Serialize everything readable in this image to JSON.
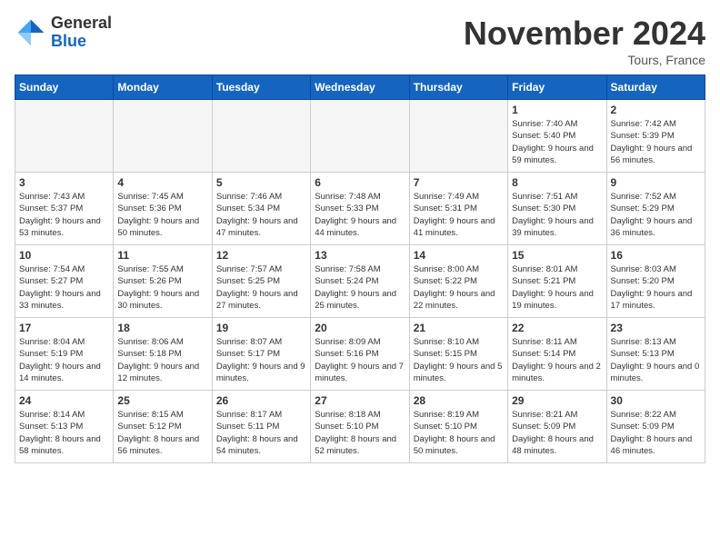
{
  "logo": {
    "general": "General",
    "blue": "Blue"
  },
  "header": {
    "month": "November 2024",
    "location": "Tours, France"
  },
  "weekdays": [
    "Sunday",
    "Monday",
    "Tuesday",
    "Wednesday",
    "Thursday",
    "Friday",
    "Saturday"
  ],
  "weeks": [
    [
      {
        "day": "",
        "info": ""
      },
      {
        "day": "",
        "info": ""
      },
      {
        "day": "",
        "info": ""
      },
      {
        "day": "",
        "info": ""
      },
      {
        "day": "",
        "info": ""
      },
      {
        "day": "1",
        "info": "Sunrise: 7:40 AM\nSunset: 5:40 PM\nDaylight: 9 hours and 59 minutes."
      },
      {
        "day": "2",
        "info": "Sunrise: 7:42 AM\nSunset: 5:39 PM\nDaylight: 9 hours and 56 minutes."
      }
    ],
    [
      {
        "day": "3",
        "info": "Sunrise: 7:43 AM\nSunset: 5:37 PM\nDaylight: 9 hours and 53 minutes."
      },
      {
        "day": "4",
        "info": "Sunrise: 7:45 AM\nSunset: 5:36 PM\nDaylight: 9 hours and 50 minutes."
      },
      {
        "day": "5",
        "info": "Sunrise: 7:46 AM\nSunset: 5:34 PM\nDaylight: 9 hours and 47 minutes."
      },
      {
        "day": "6",
        "info": "Sunrise: 7:48 AM\nSunset: 5:33 PM\nDaylight: 9 hours and 44 minutes."
      },
      {
        "day": "7",
        "info": "Sunrise: 7:49 AM\nSunset: 5:31 PM\nDaylight: 9 hours and 41 minutes."
      },
      {
        "day": "8",
        "info": "Sunrise: 7:51 AM\nSunset: 5:30 PM\nDaylight: 9 hours and 39 minutes."
      },
      {
        "day": "9",
        "info": "Sunrise: 7:52 AM\nSunset: 5:29 PM\nDaylight: 9 hours and 36 minutes."
      }
    ],
    [
      {
        "day": "10",
        "info": "Sunrise: 7:54 AM\nSunset: 5:27 PM\nDaylight: 9 hours and 33 minutes."
      },
      {
        "day": "11",
        "info": "Sunrise: 7:55 AM\nSunset: 5:26 PM\nDaylight: 9 hours and 30 minutes."
      },
      {
        "day": "12",
        "info": "Sunrise: 7:57 AM\nSunset: 5:25 PM\nDaylight: 9 hours and 27 minutes."
      },
      {
        "day": "13",
        "info": "Sunrise: 7:58 AM\nSunset: 5:24 PM\nDaylight: 9 hours and 25 minutes."
      },
      {
        "day": "14",
        "info": "Sunrise: 8:00 AM\nSunset: 5:22 PM\nDaylight: 9 hours and 22 minutes."
      },
      {
        "day": "15",
        "info": "Sunrise: 8:01 AM\nSunset: 5:21 PM\nDaylight: 9 hours and 19 minutes."
      },
      {
        "day": "16",
        "info": "Sunrise: 8:03 AM\nSunset: 5:20 PM\nDaylight: 9 hours and 17 minutes."
      }
    ],
    [
      {
        "day": "17",
        "info": "Sunrise: 8:04 AM\nSunset: 5:19 PM\nDaylight: 9 hours and 14 minutes."
      },
      {
        "day": "18",
        "info": "Sunrise: 8:06 AM\nSunset: 5:18 PM\nDaylight: 9 hours and 12 minutes."
      },
      {
        "day": "19",
        "info": "Sunrise: 8:07 AM\nSunset: 5:17 PM\nDaylight: 9 hours and 9 minutes."
      },
      {
        "day": "20",
        "info": "Sunrise: 8:09 AM\nSunset: 5:16 PM\nDaylight: 9 hours and 7 minutes."
      },
      {
        "day": "21",
        "info": "Sunrise: 8:10 AM\nSunset: 5:15 PM\nDaylight: 9 hours and 5 minutes."
      },
      {
        "day": "22",
        "info": "Sunrise: 8:11 AM\nSunset: 5:14 PM\nDaylight: 9 hours and 2 minutes."
      },
      {
        "day": "23",
        "info": "Sunrise: 8:13 AM\nSunset: 5:13 PM\nDaylight: 9 hours and 0 minutes."
      }
    ],
    [
      {
        "day": "24",
        "info": "Sunrise: 8:14 AM\nSunset: 5:13 PM\nDaylight: 8 hours and 58 minutes."
      },
      {
        "day": "25",
        "info": "Sunrise: 8:15 AM\nSunset: 5:12 PM\nDaylight: 8 hours and 56 minutes."
      },
      {
        "day": "26",
        "info": "Sunrise: 8:17 AM\nSunset: 5:11 PM\nDaylight: 8 hours and 54 minutes."
      },
      {
        "day": "27",
        "info": "Sunrise: 8:18 AM\nSunset: 5:10 PM\nDaylight: 8 hours and 52 minutes."
      },
      {
        "day": "28",
        "info": "Sunrise: 8:19 AM\nSunset: 5:10 PM\nDaylight: 8 hours and 50 minutes."
      },
      {
        "day": "29",
        "info": "Sunrise: 8:21 AM\nSunset: 5:09 PM\nDaylight: 8 hours and 48 minutes."
      },
      {
        "day": "30",
        "info": "Sunrise: 8:22 AM\nSunset: 5:09 PM\nDaylight: 8 hours and 46 minutes."
      }
    ]
  ]
}
